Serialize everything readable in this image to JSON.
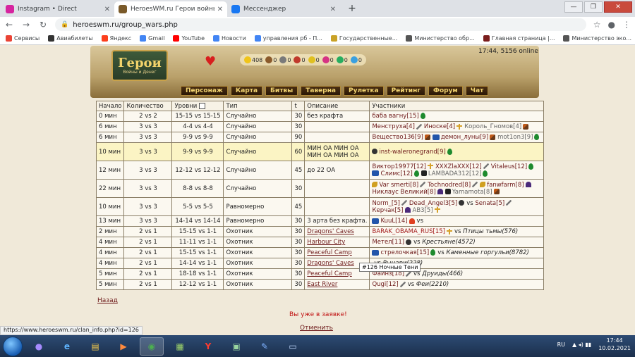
{
  "browser": {
    "tabs": [
      {
        "title": "Instagram • Direct",
        "color": "#d6249f"
      },
      {
        "title": "HeroesWM.ru Герои войны и д",
        "color": "#7a5a2a"
      },
      {
        "title": "Мессенджер",
        "color": "#1877f2"
      }
    ],
    "url": "heroeswm.ru/group_wars.php",
    "bookmarks": [
      {
        "label": "Сервисы",
        "color": "#ea4335"
      },
      {
        "label": "Авиабилеты",
        "color": "#333333"
      },
      {
        "label": "Яндекс",
        "color": "#fc3f1d"
      },
      {
        "label": "Gmail",
        "color": "#4285f4"
      },
      {
        "label": "YouTube",
        "color": "#ff0000"
      },
      {
        "label": "Новости",
        "color": "#4285f4"
      },
      {
        "label": "управления рб - П...",
        "color": "#4285f4"
      },
      {
        "label": "Государственные...",
        "color": "#c9a227"
      },
      {
        "label": "Министерство обр...",
        "color": "#555555"
      },
      {
        "label": "Главная страница |...",
        "color": "#7a1d1d"
      },
      {
        "label": "Министерство эко...",
        "color": "#555555"
      }
    ]
  },
  "game": {
    "logo_title": "Герои",
    "logo_sub": "Войны и Денег",
    "resources": [
      "408",
      "0",
      "0",
      "0",
      "0",
      "0",
      "0",
      "0"
    ],
    "online": "17:44, 5156 online",
    "menu": [
      "Персонаж",
      "Карта",
      "Битвы",
      "Таверна",
      "Рулетка",
      "Рейтинг",
      "Форум",
      "Чат"
    ]
  },
  "table": {
    "headers": [
      "Начало",
      "Количество",
      "Уровни",
      "Тип",
      "t",
      "Описание",
      "Участники"
    ],
    "rows": [
      {
        "start": "0 мин",
        "count": "2 vs 2",
        "levels": "15-15 vs 15-15",
        "type": "Случайно",
        "t": "30",
        "desc": "без крафта",
        "desc_link": false,
        "hl": false,
        "parts": [
          {
            "n": "баба вагну[15]",
            "c": "#6c1818",
            "icons": [
              "drop"
            ]
          }
        ]
      },
      {
        "start": "6 мин",
        "count": "3 vs 3",
        "levels": "4-4 vs 4-4",
        "type": "Случайно",
        "t": "30",
        "desc": "",
        "desc_link": false,
        "hl": false,
        "parts": [
          {
            "n": "Менструха[4]",
            "c": "#6c1818",
            "icons": [
              "sword"
            ]
          },
          {
            "n": "Иноске[4]",
            "c": "#6c1818",
            "icons": [
              "cross"
            ]
          },
          {
            "n": "Король_Гномов[4]",
            "c": "#666666",
            "icons": [
              "axe"
            ]
          }
        ]
      },
      {
        "start": "6 мин",
        "count": "3 vs 3",
        "levels": "9-9 vs 9-9",
        "type": "Случайно",
        "t": "90",
        "desc": "",
        "desc_link": false,
        "hl": false,
        "parts": [
          {
            "n": "Вещество136[9]",
            "c": "#6c1818",
            "icons": [
              "axe"
            ]
          },
          {
            "n": "демон_луны[9]",
            "c": "#6c1818",
            "icons": [
              "axe"
            ],
            "pre": "flag"
          },
          {
            "n": "mot1on3[9]",
            "c": "#666666",
            "icons": [
              "drop"
            ]
          }
        ]
      },
      {
        "start": "10 мин",
        "count": "3 vs 3",
        "levels": "9-9 vs 9-9",
        "type": "Случайно",
        "t": "60",
        "desc": "МИН ОА МИН ОА МИН ОА МИН ОА",
        "desc_link": false,
        "hl": true,
        "tall": true,
        "parts": [
          {
            "n": "inst-waleronegrand[9]",
            "c": "#6c1818",
            "icons": [
              "drop"
            ],
            "pre": "skull"
          }
        ]
      },
      {
        "start": "12 мин",
        "count": "3 vs 3",
        "levels": "12-12 vs 12-12",
        "type": "Случайно",
        "t": "45",
        "desc": "до 22 ОА",
        "desc_link": false,
        "hl": false,
        "tall": true,
        "parts": [
          {
            "n": "Виктор19977[12]",
            "c": "#6c1818",
            "icons": [
              "cross"
            ]
          },
          {
            "n": "XXXZlaXXX[12]",
            "c": "#6c1818",
            "icons": [
              "sword"
            ]
          },
          {
            "n": "Vitaleus[12]",
            "c": "#6c1818",
            "icons": [
              "drop"
            ]
          },
          {
            "n": "Слимс[12]",
            "c": "#6c1818",
            "icons": [
              "drop"
            ],
            "pre": "flag"
          },
          {
            "n": "LAMBADA312[12]",
            "c": "#666666",
            "icons": [
              "drop"
            ],
            "pre": "star"
          }
        ]
      },
      {
        "start": "22 мин",
        "count": "3 vs 3",
        "levels": "8-8 vs 8-8",
        "type": "Случайно",
        "t": "30",
        "desc": "",
        "desc_link": false,
        "hl": false,
        "tall": true,
        "parts": [
          {
            "n": "Var smerti[8]",
            "c": "#6c1818",
            "icons": [
              "sword"
            ],
            "pre": "bird"
          },
          {
            "n": "Tochnodred[8]",
            "c": "#6c1818",
            "icons": [
              "sword"
            ]
          },
          {
            "n": "fanwfarm[8]",
            "c": "#6c1818",
            "icons": [
              "bat"
            ],
            "pre": "bird"
          },
          {
            "n": "Никлаус Великий[8]",
            "c": "#6c1818",
            "icons": [
              "bat"
            ]
          },
          {
            "n": "Yamamota[8]",
            "c": "#666666",
            "icons": [
              "axe"
            ],
            "pre": "star"
          }
        ]
      },
      {
        "start": "10 мин",
        "count": "3 vs 3",
        "levels": "5-5 vs 5-5",
        "type": "Равномерно",
        "t": "45",
        "desc": "",
        "desc_link": false,
        "hl": false,
        "tall": true,
        "parts": [
          {
            "n": "Norm_[5]",
            "c": "#6c1818",
            "icons": [
              "sword"
            ]
          },
          {
            "n": "Dead_Angel3[5]",
            "c": "#6c1818",
            "icons": [
              "skull"
            ],
            "vs": true
          },
          {
            "n": "Senata[5]",
            "c": "#6c1818",
            "icons": [
              "sword"
            ]
          },
          {
            "n": "Керчак[5]",
            "c": "#6c1818",
            "icons": [
              "bat"
            ]
          },
          {
            "n": "AB3[5]",
            "c": "#666666",
            "icons": [
              "cross"
            ]
          }
        ]
      },
      {
        "start": "13 мин",
        "count": "3 vs 3",
        "levels": "14-14 vs 14-14",
        "type": "Равномерно",
        "t": "30",
        "desc": "3 арта без крафта.",
        "desc_link": false,
        "hl": false,
        "parts": [
          {
            "n": "KuuL[14]",
            "c": "#6c1818",
            "icons": [
              "fire"
            ],
            "pre": "flag",
            "vs": true
          }
        ]
      },
      {
        "start": "2 мин",
        "count": "2 vs 1",
        "levels": "15-15 vs 1-1",
        "type": "Охотник",
        "t": "30",
        "desc": "Dragons' Caves",
        "desc_link": true,
        "hl": false,
        "parts": [
          {
            "n": "BARAK_OBAMA_RUS[15]",
            "c": "#a31b1b",
            "icons": [
              "cross"
            ],
            "vs": true
          }
        ],
        "foe": "Птицы тьмы(576)"
      },
      {
        "start": "4 мин",
        "count": "2 vs 1",
        "levels": "11-11 vs 1-1",
        "type": "Охотник",
        "t": "30",
        "desc": "Harbour City",
        "desc_link": true,
        "hl": false,
        "parts": [
          {
            "n": "Метел[11]",
            "c": "#6c1818",
            "icons": [
              "skull"
            ],
            "vs": true
          }
        ],
        "foe": "Крестьяне(4572)"
      },
      {
        "start": "4 мин",
        "count": "2 vs 1",
        "levels": "15-15 vs 1-1",
        "type": "Охотник",
        "t": "30",
        "desc": "Peaceful Camp",
        "desc_link": true,
        "hl": false,
        "parts": [
          {
            "n": "стрелочкая[15]",
            "c": "#6c1818",
            "icons": [
              "drop"
            ],
            "pre": "flag",
            "vs": true
          }
        ],
        "foe": "Каменные горгульи(8782)"
      },
      {
        "start": "4 мин",
        "count": "2 vs 1",
        "levels": "14-14 vs 1-1",
        "type": "Охотник",
        "t": "30",
        "desc": "Dragons' Caves",
        "desc_link": true,
        "hl": false,
        "parts": [
          {
            "n": "",
            "c": "#6c1818",
            "icons": [],
            "vs": true
          }
        ],
        "foe": "Рыцари(228)"
      },
      {
        "start": "5 мин",
        "count": "2 vs 1",
        "levels": "18-18 vs 1-1",
        "type": "Охотник",
        "t": "30",
        "desc": "Peaceful Camp",
        "desc_link": true,
        "hl": false,
        "parts": [
          {
            "n": "Файнз[18]",
            "c": "#6c1818",
            "icons": [
              "sword"
            ],
            "vs": true
          }
        ],
        "foe": "Друиды(466)"
      },
      {
        "start": "5 мин",
        "count": "2 vs 1",
        "levels": "12-12 vs 1-1",
        "type": "Охотник",
        "t": "30",
        "desc": "East River",
        "desc_link": true,
        "hl": false,
        "parts": [
          {
            "n": "Qugi[12]",
            "c": "#6c1818",
            "icons": [
              "sword"
            ],
            "vs": true
          }
        ],
        "foe": "Феи(2210)"
      }
    ]
  },
  "tooltip": "#126 Ночные Тени",
  "back_link": "Назад",
  "already": "Вы уже в заявке!",
  "cancel_link": "Отменить",
  "status_url": "https://www.heroeswm.ru/clan_info.php?id=126",
  "taskbar": {
    "lang": "RU",
    "time": "17:44",
    "date": "10.02.2021"
  }
}
